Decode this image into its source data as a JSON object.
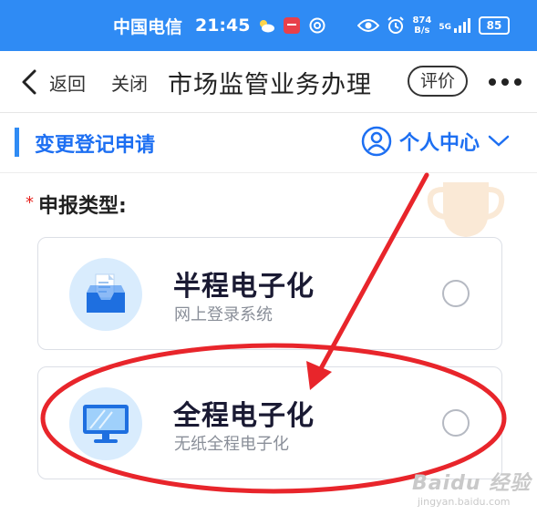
{
  "status_bar": {
    "carrier": "中国电信",
    "time": "21:45",
    "net_speed_value": "874",
    "net_speed_unit": "B/s",
    "signal_label": "5G",
    "battery": "85"
  },
  "nav": {
    "back_label": "返回",
    "close_label": "关闭",
    "title": "市场监管业务办理",
    "rate_label": "评价"
  },
  "section": {
    "title": "变更登记申请",
    "user_center_label": "个人中心"
  },
  "form": {
    "required_mark": "*",
    "label": "申报类型:",
    "options": [
      {
        "title": "半程电子化",
        "subtitle": "网上登录系统",
        "icon": "inbox-tray-icon",
        "selected": false
      },
      {
        "title": "全程电子化",
        "subtitle": "无纸全程电子化",
        "icon": "monitor-icon",
        "selected": false
      }
    ]
  },
  "watermark": {
    "main": "Baidu 经验",
    "sub": "jingyan.baidu.com"
  },
  "colors": {
    "status_bar": "#2f8bf4",
    "accent": "#1d6ff2",
    "annotation": "#e8252b",
    "required": "#e6231e"
  }
}
